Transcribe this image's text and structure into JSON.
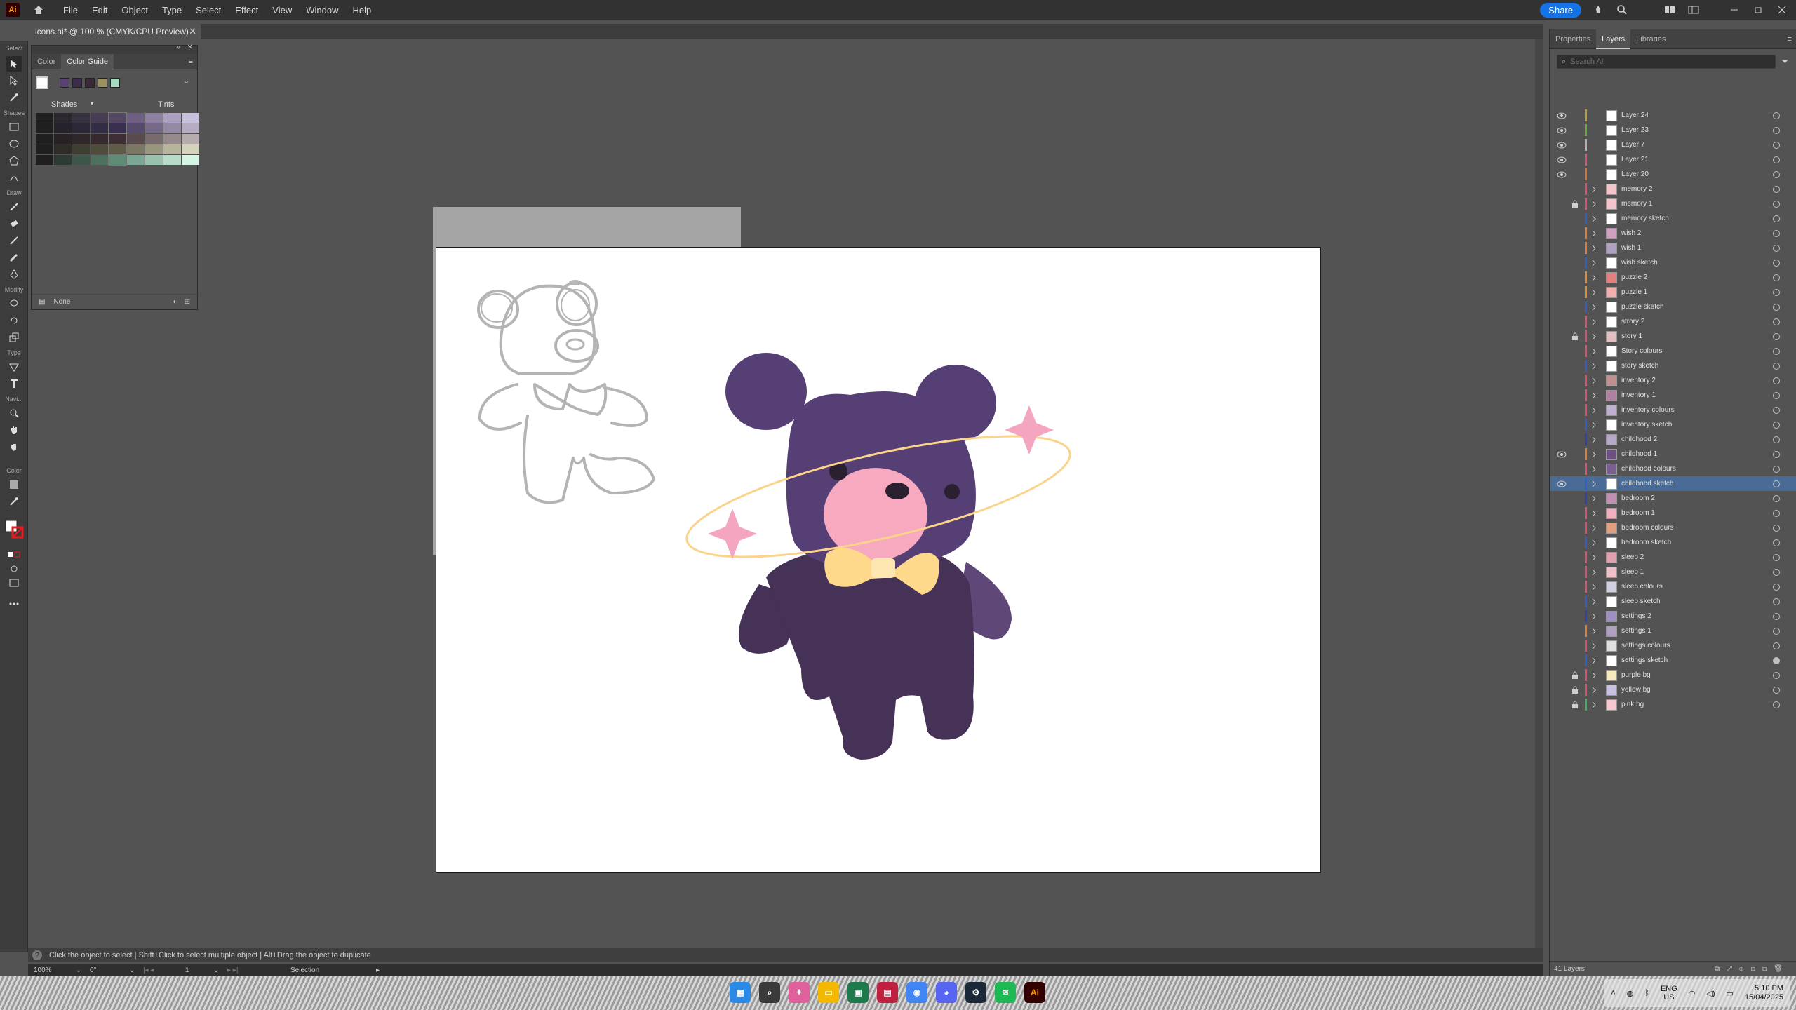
{
  "app": {
    "logo_text": "Ai",
    "menus": [
      "File",
      "Edit",
      "Object",
      "Type",
      "Select",
      "Effect",
      "View",
      "Window",
      "Help"
    ],
    "share_label": "Share"
  },
  "document": {
    "tab_title": "icons.ai* @ 100 % (CMYK/CPU Preview)"
  },
  "toolbar": {
    "sections": [
      "Select",
      "Shapes",
      "Draw",
      "Modify",
      "Type",
      "Navi...",
      "Color"
    ]
  },
  "color_panel": {
    "tabs": [
      "Color",
      "Color Guide"
    ],
    "active_tab": "Color Guide",
    "shades_label": "Shades",
    "tints_label": "Tints",
    "bottom_label": "None",
    "harmony": [
      "#ffffff",
      "#574272",
      "#3a2c4a",
      "#3a2a35",
      "#9a9060",
      "#a7d8c0"
    ],
    "grid": [
      [
        "#1f1f1f",
        "#2c2830",
        "#393341",
        "#463d52",
        "#534763",
        "#6f6083",
        "#8d80a1",
        "#aba0bf",
        "#c9c0dd"
      ],
      [
        "#1f1f1f",
        "#26222b",
        "#2d2637",
        "#342b44",
        "#3b2f50",
        "#574a6b",
        "#766a88",
        "#958aa5",
        "#b5acc3"
      ],
      [
        "#1f1f1f",
        "#282224",
        "#2f2629",
        "#372a2e",
        "#3e2e33",
        "#594a4e",
        "#786a6d",
        "#978a8d",
        "#b6acae"
      ],
      [
        "#1f1f1f",
        "#2e2d28",
        "#3e3d32",
        "#4e4d3c",
        "#5e5c46",
        "#7a7860",
        "#98967d",
        "#b6b49b",
        "#d4d3bb"
      ],
      [
        "#1f1f1f",
        "#2e3a34",
        "#3e5549",
        "#4e705e",
        "#5e8b73",
        "#7aa793",
        "#98c2ae",
        "#b6dcc9",
        "#d4f4e4"
      ]
    ]
  },
  "layers_panel": {
    "tabs": [
      "Properties",
      "Layers",
      "Libraries"
    ],
    "active_tab": "Layers",
    "search_placeholder": "Search All",
    "count_label": "41 Layers",
    "layers": [
      {
        "name": "Layer 24",
        "color": "#c0a030",
        "visible": true,
        "locked": false,
        "expand": false,
        "thumb": "#ffffff",
        "selected": false,
        "target": false
      },
      {
        "name": "Layer 23",
        "color": "#60b030",
        "visible": true,
        "locked": false,
        "expand": false,
        "thumb": "#ffffff",
        "selected": false,
        "target": false
      },
      {
        "name": "Layer 7",
        "color": "#b0b0b0",
        "visible": true,
        "locked": false,
        "expand": false,
        "thumb": "#ffffff",
        "selected": false,
        "target": false
      },
      {
        "name": "Layer 21",
        "color": "#e05070",
        "visible": true,
        "locked": false,
        "expand": false,
        "thumb": "#ffffff",
        "selected": false,
        "target": false
      },
      {
        "name": "Layer 20",
        "color": "#e07030",
        "visible": true,
        "locked": false,
        "expand": false,
        "thumb": "#ffffff",
        "selected": false,
        "target": false
      },
      {
        "name": "memory 2",
        "color": "#e05070",
        "visible": false,
        "locked": false,
        "expand": true,
        "thumb": "#f3c4c9",
        "selected": false,
        "target": false
      },
      {
        "name": "memory 1",
        "color": "#e05070",
        "visible": false,
        "locked": true,
        "expand": true,
        "thumb": "#f3c4c9",
        "selected": false,
        "target": false
      },
      {
        "name": "memory sketch",
        "color": "#3060d0",
        "visible": false,
        "locked": false,
        "expand": true,
        "thumb": "#ffffff",
        "selected": false,
        "target": false
      },
      {
        "name": "wish 2",
        "color": "#e08030",
        "visible": false,
        "locked": false,
        "expand": true,
        "thumb": "#d0a0c0",
        "selected": false,
        "target": false
      },
      {
        "name": "wish 1",
        "color": "#e08030",
        "visible": false,
        "locked": false,
        "expand": true,
        "thumb": "#b0a0c0",
        "selected": false,
        "target": false
      },
      {
        "name": "wish sketch",
        "color": "#3060d0",
        "visible": false,
        "locked": false,
        "expand": true,
        "thumb": "#ffffff",
        "selected": false,
        "target": false
      },
      {
        "name": "puzzle 2",
        "color": "#e09030",
        "visible": false,
        "locked": false,
        "expand": true,
        "thumb": "#e08080",
        "selected": false,
        "target": false
      },
      {
        "name": "puzzle 1",
        "color": "#e09030",
        "visible": false,
        "locked": false,
        "expand": true,
        "thumb": "#f0b0b0",
        "selected": false,
        "target": false
      },
      {
        "name": "puzzle sketch",
        "color": "#3060d0",
        "visible": false,
        "locked": false,
        "expand": true,
        "thumb": "#ffffff",
        "selected": false,
        "target": false
      },
      {
        "name": "strory 2",
        "color": "#e05070",
        "visible": false,
        "locked": false,
        "expand": true,
        "thumb": "#ffffff",
        "selected": false,
        "target": false
      },
      {
        "name": "story 1",
        "color": "#e05070",
        "visible": false,
        "locked": true,
        "expand": true,
        "thumb": "#e0c0c0",
        "selected": false,
        "target": false
      },
      {
        "name": "Story colours",
        "color": "#e05070",
        "visible": false,
        "locked": false,
        "expand": true,
        "thumb": "#ffffff",
        "selected": false,
        "target": false
      },
      {
        "name": "story sketch",
        "color": "#3060d0",
        "visible": false,
        "locked": false,
        "expand": true,
        "thumb": "#ffffff",
        "selected": false,
        "target": false
      },
      {
        "name": "inventory 2",
        "color": "#e05070",
        "visible": false,
        "locked": false,
        "expand": true,
        "thumb": "#c09090",
        "selected": false,
        "target": false
      },
      {
        "name": "inventory 1",
        "color": "#e05070",
        "visible": false,
        "locked": false,
        "expand": true,
        "thumb": "#b080a0",
        "selected": false,
        "target": false
      },
      {
        "name": "inventory colours",
        "color": "#e05070",
        "visible": false,
        "locked": false,
        "expand": true,
        "thumb": "#c0b0d0",
        "selected": false,
        "target": false
      },
      {
        "name": "inventory sketch",
        "color": "#3060d0",
        "visible": false,
        "locked": false,
        "expand": true,
        "thumb": "#ffffff",
        "selected": false,
        "target": false
      },
      {
        "name": "childhood 2",
        "color": "#3040b0",
        "visible": false,
        "locked": false,
        "expand": true,
        "thumb": "#b8a8c8",
        "selected": false,
        "target": false
      },
      {
        "name": "childhood 1",
        "color": "#e08030",
        "visible": true,
        "locked": false,
        "expand": true,
        "thumb": "#6a5080",
        "selected": false,
        "target": false
      },
      {
        "name": "childhood colours",
        "color": "#e05070",
        "visible": false,
        "locked": false,
        "expand": true,
        "thumb": "#7a6090",
        "selected": false,
        "target": false
      },
      {
        "name": "childhood sketch",
        "color": "#3060d0",
        "visible": true,
        "locked": false,
        "expand": true,
        "thumb": "#ffffff",
        "selected": true,
        "target": false
      },
      {
        "name": "bedroom 2",
        "color": "#3040b0",
        "visible": false,
        "locked": false,
        "expand": true,
        "thumb": "#c090b0",
        "selected": false,
        "target": false
      },
      {
        "name": "bedroom 1",
        "color": "#e05070",
        "visible": false,
        "locked": false,
        "expand": true,
        "thumb": "#f0b0c0",
        "selected": false,
        "target": false
      },
      {
        "name": "bedroom colours",
        "color": "#e05070",
        "visible": false,
        "locked": false,
        "expand": true,
        "thumb": "#e0a080",
        "selected": false,
        "target": false
      },
      {
        "name": "bedroom sketch",
        "color": "#3060d0",
        "visible": false,
        "locked": false,
        "expand": true,
        "thumb": "#ffffff",
        "selected": false,
        "target": false
      },
      {
        "name": "sleep 2",
        "color": "#e05070",
        "visible": false,
        "locked": false,
        "expand": true,
        "thumb": "#e0a0b0",
        "selected": false,
        "target": false
      },
      {
        "name": "sleep 1",
        "color": "#e05070",
        "visible": false,
        "locked": false,
        "expand": true,
        "thumb": "#f0c0c8",
        "selected": false,
        "target": false
      },
      {
        "name": "sleep colours",
        "color": "#e05070",
        "visible": false,
        "locked": false,
        "expand": true,
        "thumb": "#d0d0e0",
        "selected": false,
        "target": false
      },
      {
        "name": "sleep sketch",
        "color": "#3060d0",
        "visible": false,
        "locked": false,
        "expand": true,
        "thumb": "#ffffff",
        "selected": false,
        "target": false
      },
      {
        "name": "settings 2",
        "color": "#3040b0",
        "visible": false,
        "locked": false,
        "expand": true,
        "thumb": "#a090c0",
        "selected": false,
        "target": false
      },
      {
        "name": "settings 1",
        "color": "#e08030",
        "visible": false,
        "locked": false,
        "expand": true,
        "thumb": "#b0a0c0",
        "selected": false,
        "target": false
      },
      {
        "name": "settings colours",
        "color": "#e05070",
        "visible": false,
        "locked": false,
        "expand": true,
        "thumb": "#e0e0e0",
        "selected": false,
        "target": false
      },
      {
        "name": "settings sketch",
        "color": "#3060d0",
        "visible": false,
        "locked": false,
        "expand": true,
        "thumb": "#ffffff",
        "selected": false,
        "target": true
      },
      {
        "name": "purple bg",
        "color": "#e05070",
        "visible": false,
        "locked": true,
        "expand": true,
        "thumb": "#f6e9c0",
        "selected": false,
        "target": false
      },
      {
        "name": "yellow bg",
        "color": "#e05070",
        "visible": false,
        "locked": true,
        "expand": true,
        "thumb": "#c8c0e0",
        "selected": false,
        "target": false
      },
      {
        "name": "pink bg",
        "color": "#40b060",
        "visible": false,
        "locked": true,
        "expand": true,
        "thumb": "#f6c8d0",
        "selected": false,
        "target": false
      }
    ]
  },
  "hints": {
    "text": "Click the object to select  |  Shift+Click to select multiple object  |  Alt+Drag the object to duplicate"
  },
  "status": {
    "zoom": "100%",
    "rotation": "0°",
    "artboard": "1",
    "tool": "Selection"
  },
  "taskbar": {
    "lang_top": "ENG",
    "lang_bottom": "US",
    "time": "5:10 PM",
    "date": "15/04/2025"
  },
  "artwork": {
    "bear_body": "#463157",
    "bear_head": "#563f75",
    "bear_muzzle": "#f6a9bf",
    "bear_bow": "#fed98b",
    "sparkle": "#f4a6c0",
    "orbit": "#fbd38b",
    "sketch_stroke": "#b4b4b4"
  }
}
